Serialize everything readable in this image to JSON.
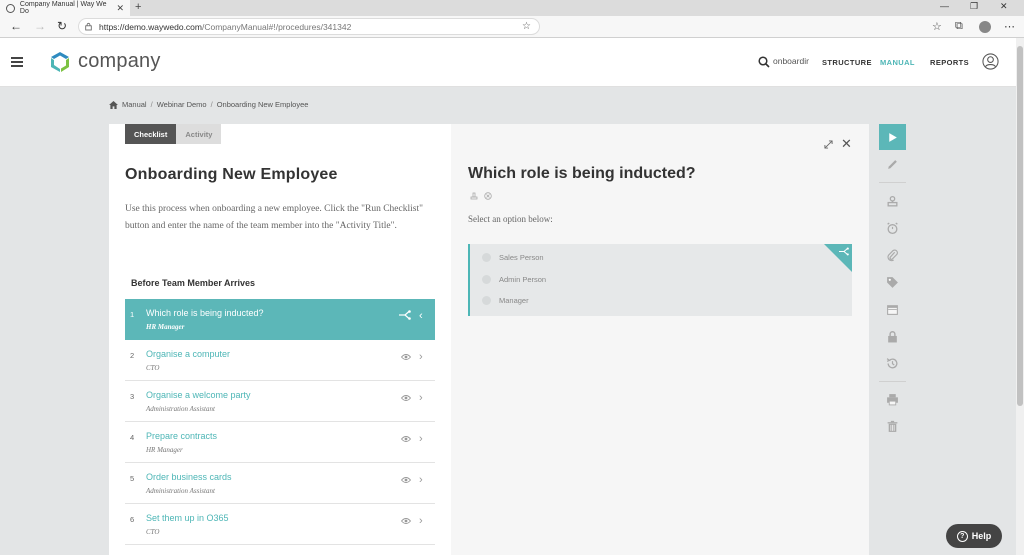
{
  "browser": {
    "tab_title": "Company Manual | Way We Do",
    "url_host": "https://demo.waywedo.com",
    "url_path": "/CompanyManual#!/procedures/341342"
  },
  "header": {
    "brand": "company",
    "search_value": "onboardin",
    "nav": [
      "STRUCTURE",
      "MANUAL",
      "REPORTS"
    ],
    "active_nav": "MANUAL"
  },
  "breadcrumb": [
    "Manual",
    "Webinar Demo",
    "Onboarding New Employee"
  ],
  "left": {
    "tabs": [
      "Checklist",
      "Activity"
    ],
    "title": "Onboarding New Employee",
    "description": "Use this process when onboarding a new employee. Click the \"Run Checklist\" button and enter the name of the team member into the \"Activity Title\".",
    "section": "Before Team Member Arrives",
    "steps": [
      {
        "num": "1",
        "title": "Which role is being inducted?",
        "role": "HR Manager"
      },
      {
        "num": "2",
        "title": "Organise a computer",
        "role": "CTO"
      },
      {
        "num": "3",
        "title": "Organise a welcome party",
        "role": "Administration Assistant"
      },
      {
        "num": "4",
        "title": "Prepare contracts",
        "role": "HR Manager"
      },
      {
        "num": "5",
        "title": "Order business cards",
        "role": "Administration Assistant"
      },
      {
        "num": "6",
        "title": "Set them up in O365",
        "role": "CTO"
      }
    ]
  },
  "right": {
    "title": "Which role is being inducted?",
    "prompt": "Select an option below:",
    "options": [
      "Sales Person",
      "Admin Person",
      "Manager"
    ]
  },
  "help_label": "Help",
  "colors": {
    "accent": "#5cb7b8",
    "dark": "#555555"
  }
}
